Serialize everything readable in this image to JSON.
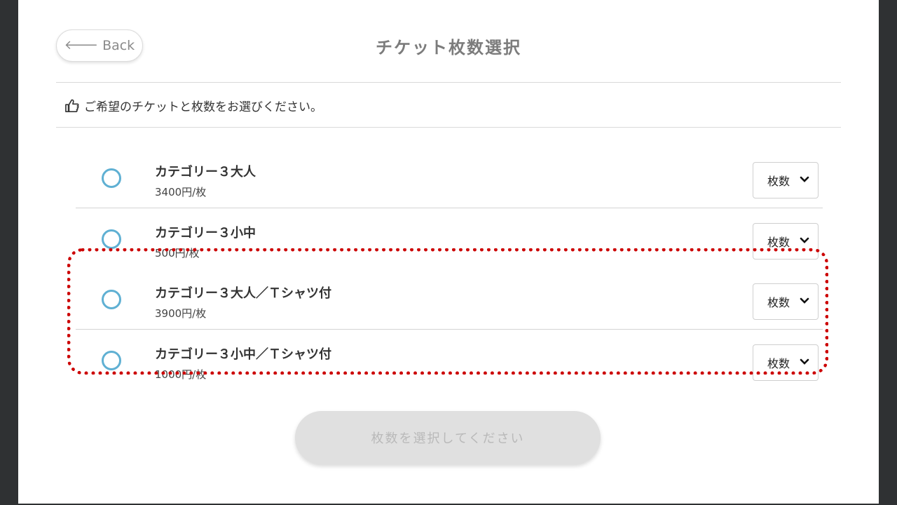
{
  "header": {
    "back_label": "Back",
    "title": "チケット枚数選択"
  },
  "instruction": "ご希望のチケットと枚数をお選びください。",
  "tickets": [
    {
      "name": "カテゴリー３大人",
      "price": "3400円/枚",
      "qty_label": "枚数"
    },
    {
      "name": "カテゴリー３小中",
      "price": "500円/枚",
      "qty_label": "枚数"
    },
    {
      "name": "カテゴリー３大人／Ｔシャツ付",
      "price": "3900円/枚",
      "qty_label": "枚数"
    },
    {
      "name": "カテゴリー３小中／Ｔシャツ付",
      "price": "1000円/枚",
      "qty_label": "枚数"
    }
  ],
  "submit_label": "枚数を選択してください",
  "colors": {
    "radio": "#5fb0d3",
    "highlight": "#cc0000",
    "disabled_button": "#e0e0e0"
  }
}
